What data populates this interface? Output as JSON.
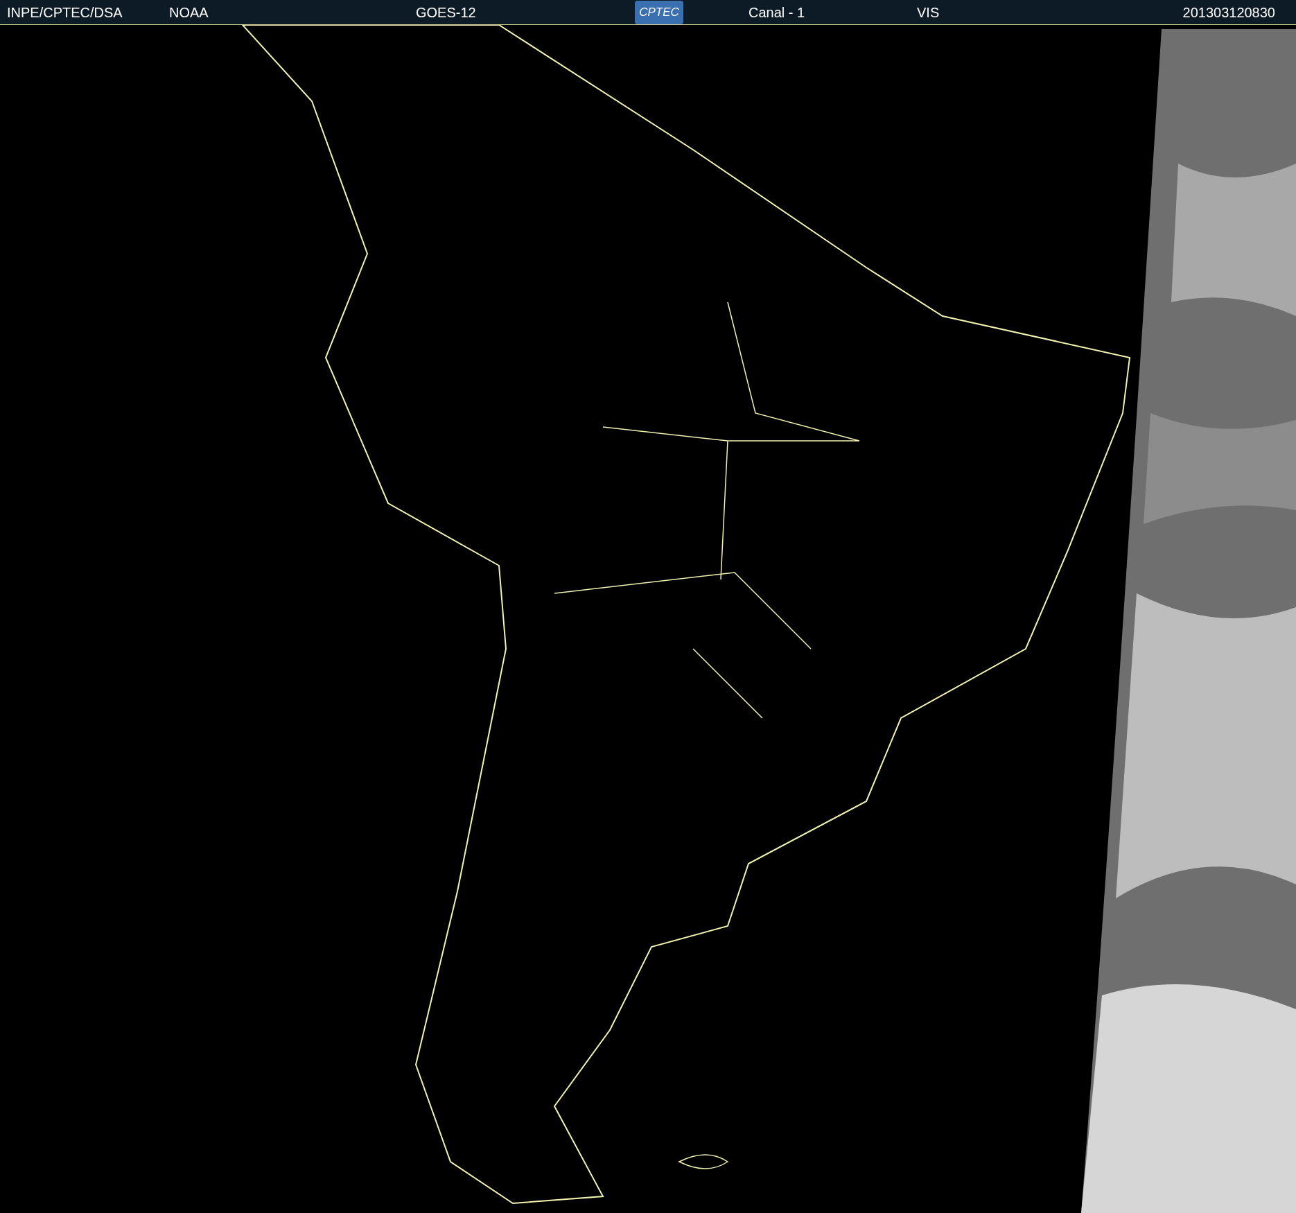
{
  "header": {
    "source": "INPE/CPTEC/DSA",
    "agency": "NOAA",
    "satellite": "GOES-12",
    "logo": "CPTEC",
    "channel": "Canal - 1",
    "band": "VIS",
    "timestamp": "201303120830"
  }
}
